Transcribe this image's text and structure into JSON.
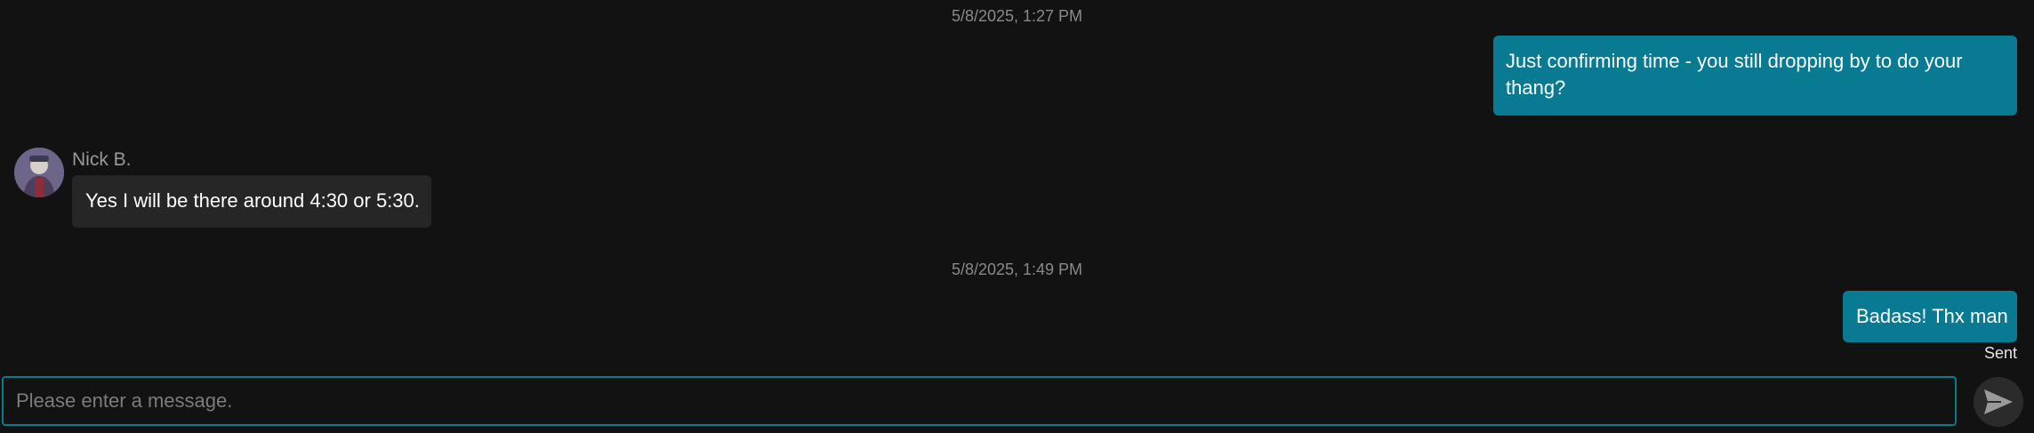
{
  "messages": {
    "timestamp_1": "5/8/2025, 1:27 PM",
    "outgoing_1": "Just confirming time - you still dropping by to do your thang?",
    "incoming_sender": "Nick B.",
    "incoming_1": "Yes I will be there around 4:30 or 5:30.",
    "timestamp_2": "5/8/2025, 1:49 PM",
    "outgoing_2": "Badass! Thx man",
    "status": "Sent"
  },
  "composer": {
    "placeholder": "Please enter a message.",
    "value": ""
  },
  "icons": {
    "avatar": "contact-avatar",
    "send": "send-icon"
  },
  "colors": {
    "background": "#121212",
    "outgoing_bubble": "#087a92",
    "incoming_bubble": "#262626",
    "accent": "#087a92"
  }
}
